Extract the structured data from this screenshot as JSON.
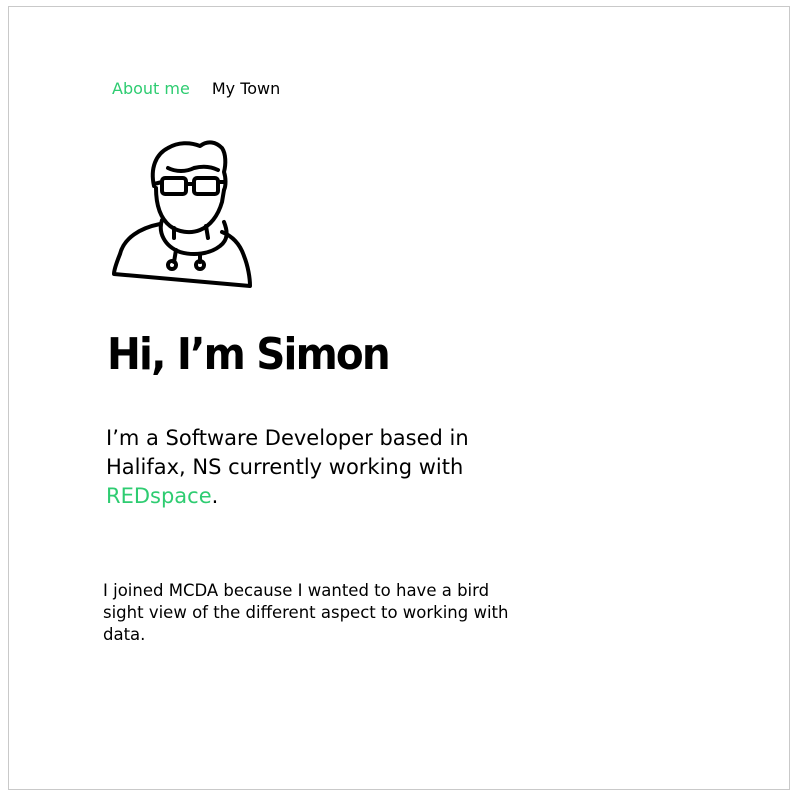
{
  "nav": {
    "items": [
      {
        "label": "About me",
        "active": true
      },
      {
        "label": "My Town",
        "active": false
      }
    ]
  },
  "avatar": {
    "icon": "developer-avatar-icon"
  },
  "hero": {
    "title": "Hi, I’m Simon"
  },
  "intro": {
    "text_before": "I’m a Software Developer based in Halifax, NS currently working with",
    "link_text": "REDspace",
    "text_after": "."
  },
  "about": {
    "text": "I joined MCDA because I wanted to have a bird sight view of the different aspect to working with data."
  },
  "colors": {
    "accent": "#2ecc71",
    "text": "#000000",
    "border": "#c9c9c9"
  }
}
